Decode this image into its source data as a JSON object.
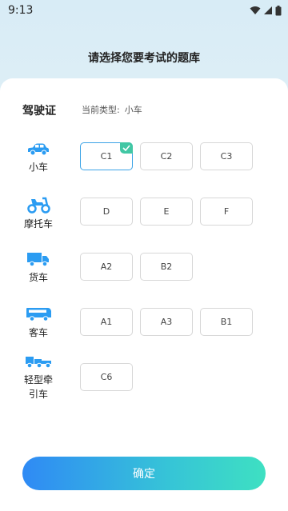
{
  "status_bar": {
    "time": "9:13"
  },
  "title": "请选择您要考试的题库",
  "license": {
    "label": "驾驶证",
    "current_type_prefix": "当前类型:",
    "current_type_value": "小车"
  },
  "colors": {
    "accent": "#2f8af5",
    "vehicle_icon": "#2b9cf2",
    "check": "#41c7a4"
  },
  "rows": [
    {
      "vehicle": "小车",
      "icon": "car-icon",
      "options": [
        {
          "label": "C1",
          "selected": true
        },
        {
          "label": "C2"
        },
        {
          "label": "C3"
        }
      ]
    },
    {
      "vehicle": "摩托车",
      "icon": "motorcycle-icon",
      "options": [
        {
          "label": "D"
        },
        {
          "label": "E"
        },
        {
          "label": "F"
        }
      ]
    },
    {
      "vehicle": "货车",
      "icon": "truck-icon",
      "options": [
        {
          "label": "A2"
        },
        {
          "label": "B2"
        }
      ]
    },
    {
      "vehicle": "客车",
      "icon": "bus-icon",
      "options": [
        {
          "label": "A1"
        },
        {
          "label": "A3"
        },
        {
          "label": "B1"
        }
      ]
    },
    {
      "vehicle_line1": "轻型牵",
      "vehicle_line2": "引车",
      "icon": "tractor-icon",
      "options": [
        {
          "label": "C6"
        }
      ]
    }
  ],
  "confirm_label": "确定"
}
